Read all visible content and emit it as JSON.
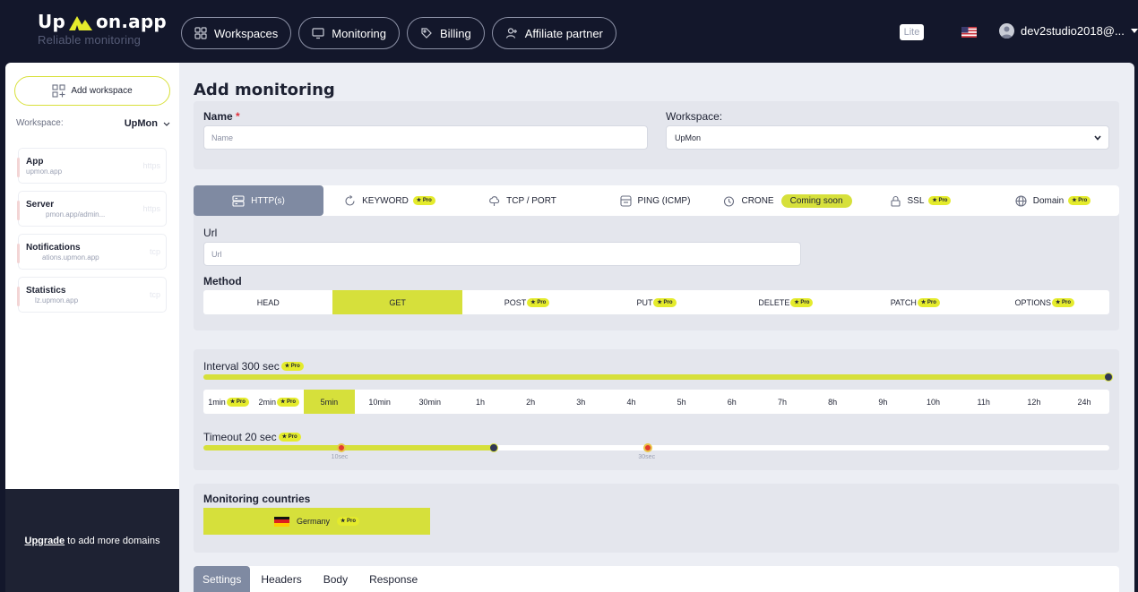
{
  "colors": {
    "accent": "#d6e03b",
    "dark": "#13172b",
    "active_tab": "#7f8aa2",
    "required": "#e0313b"
  },
  "brand": {
    "name_left": "Up",
    "name_right": "on.app",
    "tagline": "Reliable monitoring"
  },
  "nav": [
    {
      "label": "Workspaces",
      "icon": "grid-icon"
    },
    {
      "label": "Monitoring",
      "icon": "monitor-icon"
    },
    {
      "label": "Billing",
      "icon": "tag-icon"
    },
    {
      "label": "Affiliate partner",
      "icon": "user-plus-icon"
    }
  ],
  "header": {
    "plan": "Lite",
    "user": "dev2studio2018@..."
  },
  "sidebar": {
    "add_workspace": "Add workspace",
    "workspace_label": "Workspace:",
    "workspace_value": "UpMon",
    "sites": [
      {
        "name": "App",
        "url": "upmon.app",
        "proto": "https"
      },
      {
        "name": "Server",
        "url": "pmon.app/admin...",
        "proto": "https"
      },
      {
        "name": "Notifications",
        "url": "ations.upmon.app",
        "proto": "tcp"
      },
      {
        "name": "Statistics",
        "url": "lz.upmon.app",
        "proto": "tcp"
      }
    ],
    "upgrade_link": "Upgrade",
    "upgrade_text": "to add more domains"
  },
  "form": {
    "title": "Add monitoring",
    "name_label": "Name",
    "required_mark": "*",
    "name_placeholder": "Name",
    "workspace_label": "Workspace:",
    "workspace_value": "UpMon",
    "types": [
      {
        "label": "HTTP(s)",
        "icon": "server-icon",
        "active": true
      },
      {
        "label": "KEYWORD",
        "icon": "refresh-icon",
        "pro": "Pro"
      },
      {
        "label": "TCP / PORT",
        "icon": "cloud-icon"
      },
      {
        "label": "PING (ICMP)",
        "icon": "ping-icon"
      },
      {
        "label": "CRONE",
        "icon": "clock-icon",
        "coming": "Coming soon"
      },
      {
        "label": "SSL",
        "icon": "lock-icon",
        "pro": "Pro"
      },
      {
        "label": "Domain",
        "icon": "globe-icon",
        "pro": "Pro"
      }
    ],
    "url_label": "Url",
    "url_placeholder": "Url",
    "method_label": "Method",
    "methods": [
      {
        "label": "HEAD"
      },
      {
        "label": "GET",
        "active": true
      },
      {
        "label": "POST",
        "pro": "Pro"
      },
      {
        "label": "PUT",
        "pro": "Pro"
      },
      {
        "label": "DELETE",
        "pro": "Pro"
      },
      {
        "label": "PATCH",
        "pro": "Pro"
      },
      {
        "label": "OPTIONS",
        "pro": "Pro"
      }
    ],
    "interval_label": "Interval 300 sec",
    "interval_fill": 1.0,
    "intervals": [
      {
        "label": "1min",
        "pro": "Pro"
      },
      {
        "label": "2min",
        "pro": "Pro"
      },
      {
        "label": "5min",
        "active": true
      },
      {
        "label": "10min"
      },
      {
        "label": "30min"
      },
      {
        "label": "1h"
      },
      {
        "label": "2h"
      },
      {
        "label": "3h"
      },
      {
        "label": "4h"
      },
      {
        "label": "5h"
      },
      {
        "label": "6h"
      },
      {
        "label": "7h"
      },
      {
        "label": "8h"
      },
      {
        "label": "9h"
      },
      {
        "label": "10h"
      },
      {
        "label": "11h"
      },
      {
        "label": "12h"
      },
      {
        "label": "24h"
      }
    ],
    "timeout_label": "Timeout 20 sec",
    "timeout_fill": 0.32,
    "timeout_ticks": [
      {
        "label": "10sec",
        "pos": 0.152
      },
      {
        "label": "30sec",
        "pos": 0.491
      }
    ],
    "pro_badge": "Pro",
    "countries_label": "Monitoring countries",
    "country": "Germany",
    "bottom_tabs": [
      {
        "label": "Settings",
        "active": true
      },
      {
        "label": "Headers"
      },
      {
        "label": "Body"
      },
      {
        "label": "Response"
      }
    ]
  }
}
